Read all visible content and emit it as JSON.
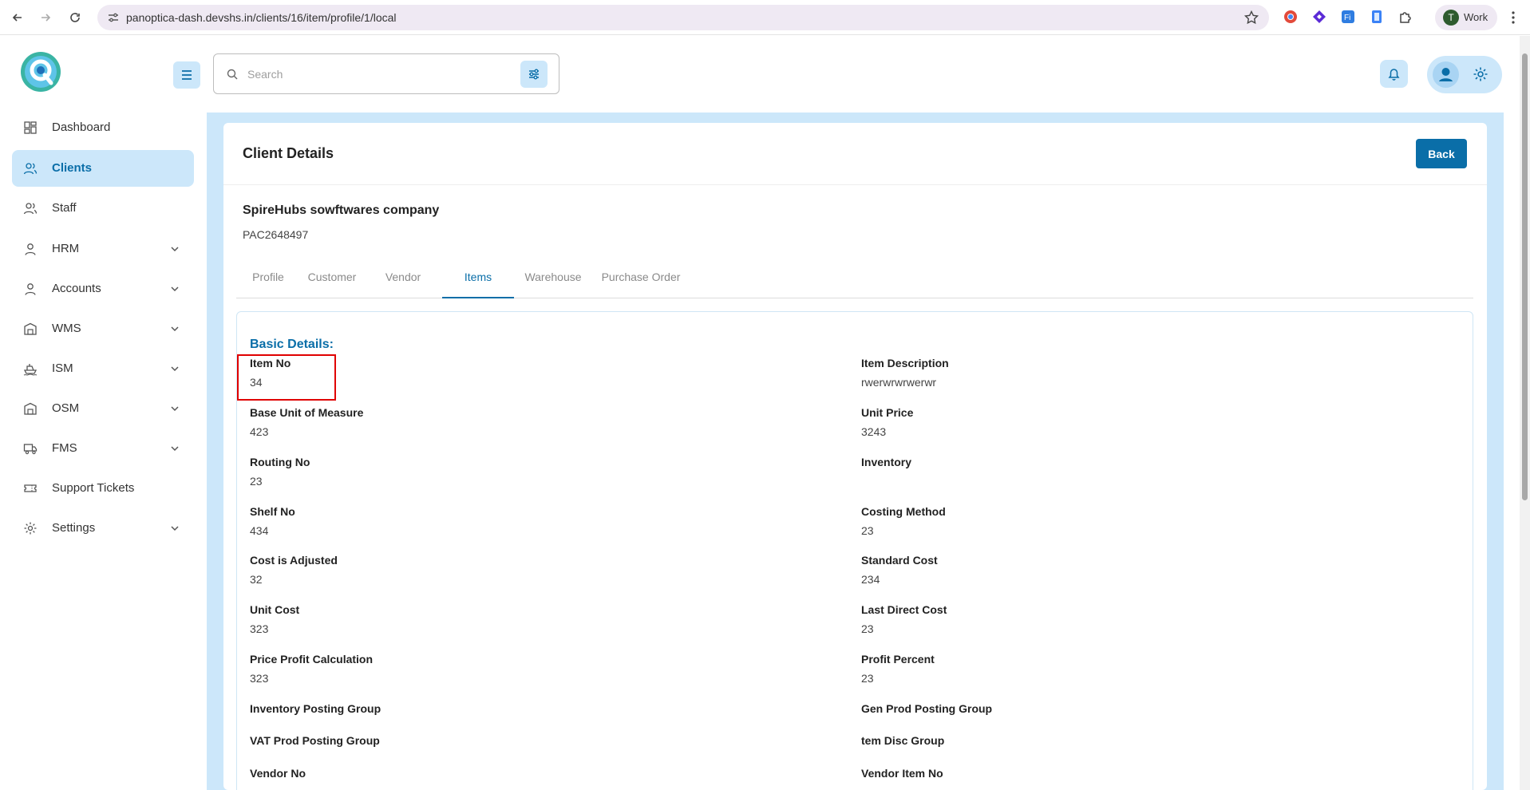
{
  "browser": {
    "url": "panoptica-dash.devshs.in/clients/16/item/profile/1/local",
    "profile_initial": "T",
    "profile_label": "Work"
  },
  "search": {
    "placeholder": "Search"
  },
  "sidebar": {
    "items": [
      {
        "label": "Dashboard",
        "icon": "dashboard-icon",
        "active": false,
        "expandable": false
      },
      {
        "label": "Clients",
        "icon": "users-icon",
        "active": true,
        "expandable": false
      },
      {
        "label": "Staff",
        "icon": "users-icon",
        "active": false,
        "expandable": false
      },
      {
        "label": "HRM",
        "icon": "user-icon",
        "active": false,
        "expandable": true
      },
      {
        "label": "Accounts",
        "icon": "user-icon",
        "active": false,
        "expandable": true
      },
      {
        "label": "WMS",
        "icon": "warehouse-icon",
        "active": false,
        "expandable": true
      },
      {
        "label": "ISM",
        "icon": "ship-icon",
        "active": false,
        "expandable": true
      },
      {
        "label": "OSM",
        "icon": "warehouse-icon",
        "active": false,
        "expandable": true
      },
      {
        "label": "FMS",
        "icon": "truck-icon",
        "active": false,
        "expandable": true
      },
      {
        "label": "Support Tickets",
        "icon": "ticket-icon",
        "active": false,
        "expandable": false
      },
      {
        "label": "Settings",
        "icon": "gear-icon",
        "active": false,
        "expandable": true
      }
    ]
  },
  "page": {
    "title": "Client Details",
    "back_label": "Back",
    "company_name": "SpireHubs sowftwares company",
    "company_code": "PAC2648497"
  },
  "tabs": [
    {
      "label": "Profile",
      "active": false
    },
    {
      "label": "Customer",
      "active": false
    },
    {
      "label": "Vendor",
      "active": false
    },
    {
      "label": "Items",
      "active": true
    },
    {
      "label": "Warehouse",
      "active": false
    },
    {
      "label": "Purchase Order",
      "active": false
    }
  ],
  "details": {
    "section_title": "Basic Details:",
    "left_fields": [
      {
        "label": "Item No",
        "value": "34"
      },
      {
        "label": "Base Unit of Measure",
        "value": "423"
      },
      {
        "label": "Routing No",
        "value": "23"
      },
      {
        "label": "Shelf No",
        "value": "434"
      },
      {
        "label": "Cost is Adjusted",
        "value": "32"
      },
      {
        "label": "Unit Cost",
        "value": "323"
      },
      {
        "label": "Price Profit Calculation",
        "value": "323"
      },
      {
        "label": "Inventory Posting Group",
        "value": ""
      },
      {
        "label": "VAT Prod Posting Group",
        "value": ""
      },
      {
        "label": "Vendor No",
        "value": ""
      }
    ],
    "right_fields": [
      {
        "label": "Item Description",
        "value": "rwerwrwrwerwr"
      },
      {
        "label": "Unit Price",
        "value": "3243"
      },
      {
        "label": "Inventory",
        "value": ""
      },
      {
        "label": "Costing Method",
        "value": "23"
      },
      {
        "label": "Standard Cost",
        "value": "234"
      },
      {
        "label": "Last Direct Cost",
        "value": "23"
      },
      {
        "label": "Profit Percent",
        "value": "23"
      },
      {
        "label": "Gen Prod Posting Group",
        "value": ""
      },
      {
        "label": "tem Disc Group",
        "value": ""
      },
      {
        "label": "Vendor Item No",
        "value": ""
      }
    ]
  },
  "colors": {
    "accent": "#0a6ea8",
    "accent_light": "#cce7fa",
    "highlight": "#e00000"
  }
}
